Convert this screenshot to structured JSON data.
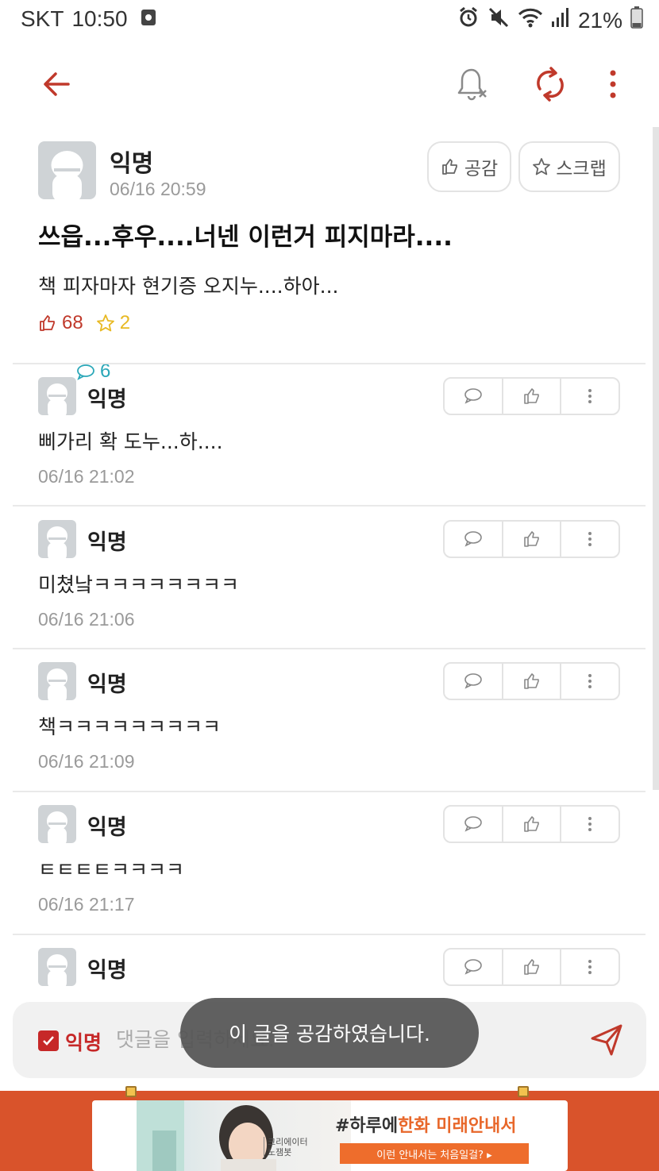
{
  "status_bar": {
    "carrier": "SKT",
    "time": "10:50",
    "battery": "21%"
  },
  "app_bar": {
    "icons": [
      "back-arrow-icon",
      "bell-off-icon",
      "refresh-icon",
      "more-vertical-icon"
    ]
  },
  "colors": {
    "accent": "#c0392b",
    "comment_stat": "#2aa7b8",
    "scrap_stat": "#e8b923",
    "ad_background": "#d9532b"
  },
  "post": {
    "author": "익명",
    "time": "06/16 20:59",
    "like_button": "공감",
    "scrap_button": "스크랩",
    "title": "쓰읍...후우....너넨 이런거 피지마라....",
    "body": "책 피자마자 현기증 오지누....하아...",
    "likes": "68",
    "comments": "6",
    "scraps": "2"
  },
  "comments": [
    {
      "author": "익명",
      "text": "삐가리 확 도누...하....",
      "time": "06/16 21:02"
    },
    {
      "author": "익명",
      "text": "미쳤낰ㅋㅋㅋㅋㅋㅋㅋㅋ",
      "time": "06/16 21:06"
    },
    {
      "author": "익명",
      "text": "책ㅋㅋㅋㅋㅋㅋㅋㅋㅋ",
      "time": "06/16 21:09"
    },
    {
      "author": "익명",
      "text": "ㅌㅌㅌㅌㅋㅋㅋㅋ",
      "time": "06/16 21:17"
    },
    {
      "author": "익명",
      "text": "",
      "time": ""
    }
  ],
  "input_bar": {
    "anon_label": "익명",
    "placeholder": "댓글을 입력하세요."
  },
  "toast": "이 글을 공감하였습니다.",
  "ad": {
    "creator": "크리에이터\n노잼봇",
    "tagline_prefix": "#하루에",
    "tagline_brand": "한화",
    "tagline_suffix": " 미래안내서",
    "cta": "이런 안내서는 처음일걸? ▸"
  }
}
